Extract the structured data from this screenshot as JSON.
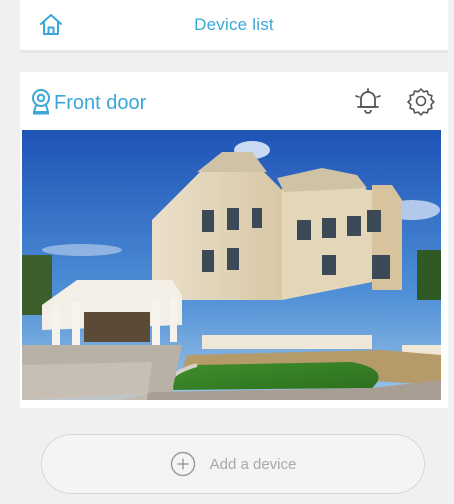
{
  "header": {
    "title": "Device list",
    "home_icon": "home-icon"
  },
  "device": {
    "name": "Front door",
    "camera_icon": "camera-pin-icon",
    "alarm_icon": "bell-icon",
    "settings_icon": "gear-icon",
    "snapshot": "house-photo"
  },
  "actions": {
    "add_device_label": "Add a device",
    "add_icon": "plus-circle-icon"
  },
  "colors": {
    "accent": "#3aa7d8",
    "background": "#f0f0f0",
    "card": "#ffffff"
  }
}
